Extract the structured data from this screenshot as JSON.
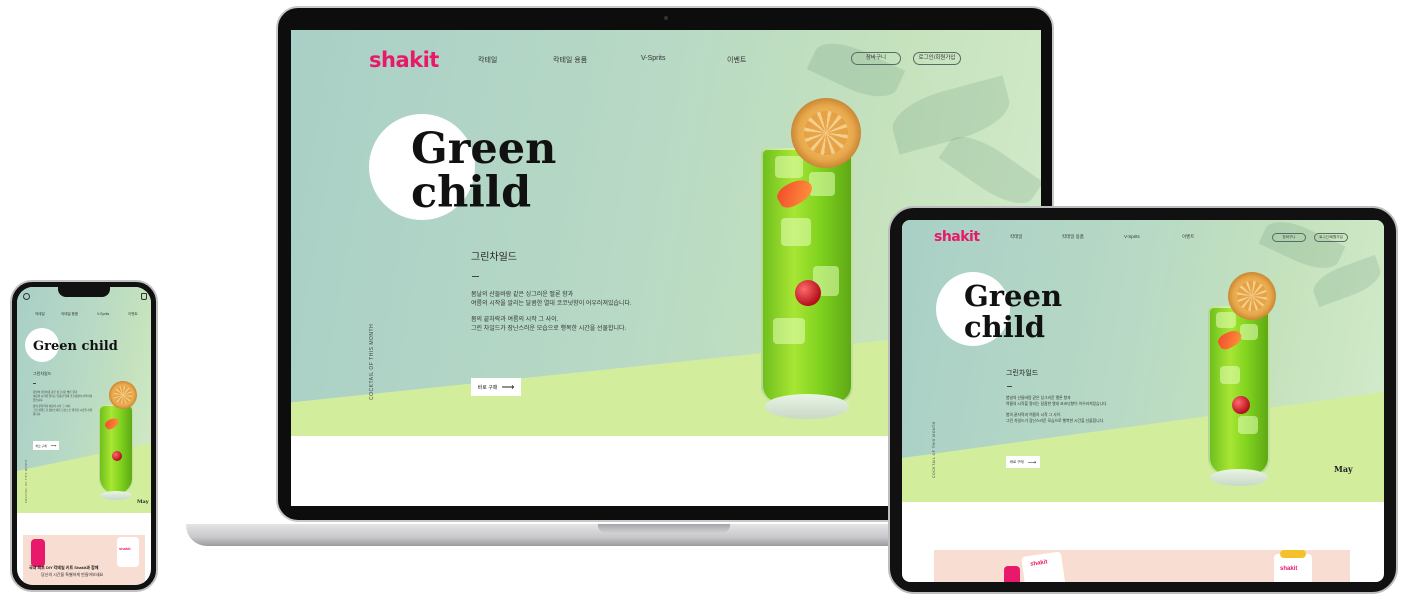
{
  "site": {
    "logo": "shakit",
    "nav": [
      "칵테일",
      "칵테일 용품",
      "V-Sprits",
      "이벤트"
    ],
    "cart_label": "장바구니",
    "login_label": "로그인/회원가입",
    "title_line1": "Green",
    "title_line2": "child",
    "title_single": "Green child",
    "subtitle": "그린차일드",
    "desc": [
      "봄날의 산들바람 같은 싱그러운 멜론 향과",
      "여름의 시작을 알리는 달콤한 열대 코코넛향이 어우러져있습니다.",
      "봄의 끝자락과 여름의 시작 그 사이.",
      "그린 차일드가 장난스러운 모습으로 행복한 시간을 선물합니다."
    ],
    "buy_label": "바로 구매",
    "arrow": "⟶",
    "vertical_text": "COCKTAIL OF THIS MONTH",
    "month": "May",
    "banner_line1": "국내 최초 DIY 칵테일 키트 Shakit과 함께",
    "banner_line2": "당신의 시간을 특별하게 만들어보세요",
    "can_label": "shakit"
  },
  "colors": {
    "brand": "#e8196b",
    "hero_green": "#b7d9c5",
    "floor_lime": "#d2ee9d",
    "banner_pink": "#f8ddd2"
  },
  "icons": {
    "phone_user": "user-icon",
    "phone_cart": "bag-icon"
  }
}
